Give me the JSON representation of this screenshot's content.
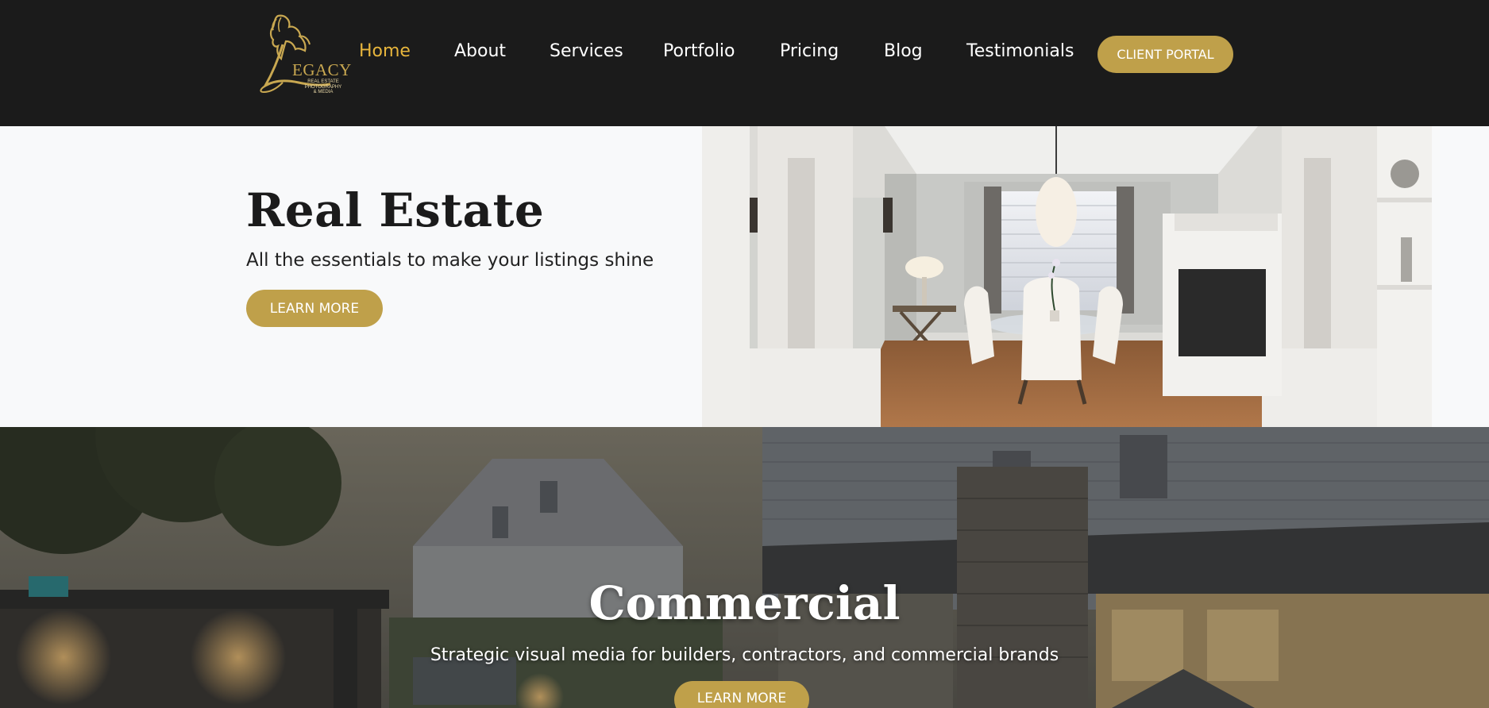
{
  "colors": {
    "header_bg": "#1b1b1b",
    "accent_gold": "#bfa04a",
    "active_nav": "#e7b53c",
    "page_bg": "#f8f9fa"
  },
  "header": {
    "logo": {
      "icon": "horse-logo-icon",
      "word": "EGACY",
      "tagline_lines": [
        "REAL ESTATE",
        "PHOTOGRAPHY",
        "& MEDIA"
      ]
    },
    "nav": [
      {
        "label": "Home",
        "active": true
      },
      {
        "label": "About",
        "active": false
      },
      {
        "label": "Services",
        "active": false
      },
      {
        "label": "Portfolio",
        "active": false
      },
      {
        "label": "Pricing",
        "active": false
      },
      {
        "label": "Blog",
        "active": false
      },
      {
        "label": "Testimonials",
        "active": false
      }
    ],
    "portal_button": "CLIENT PORTAL"
  },
  "real_estate": {
    "title": "Real Estate",
    "subtitle": "All the essentials to make your listings shine",
    "button": "LEARN MORE"
  },
  "commercial": {
    "title": "Commercial",
    "subtitle": "Strategic visual media for builders, contractors, and commercial brands",
    "button": "LEARN MORE"
  }
}
